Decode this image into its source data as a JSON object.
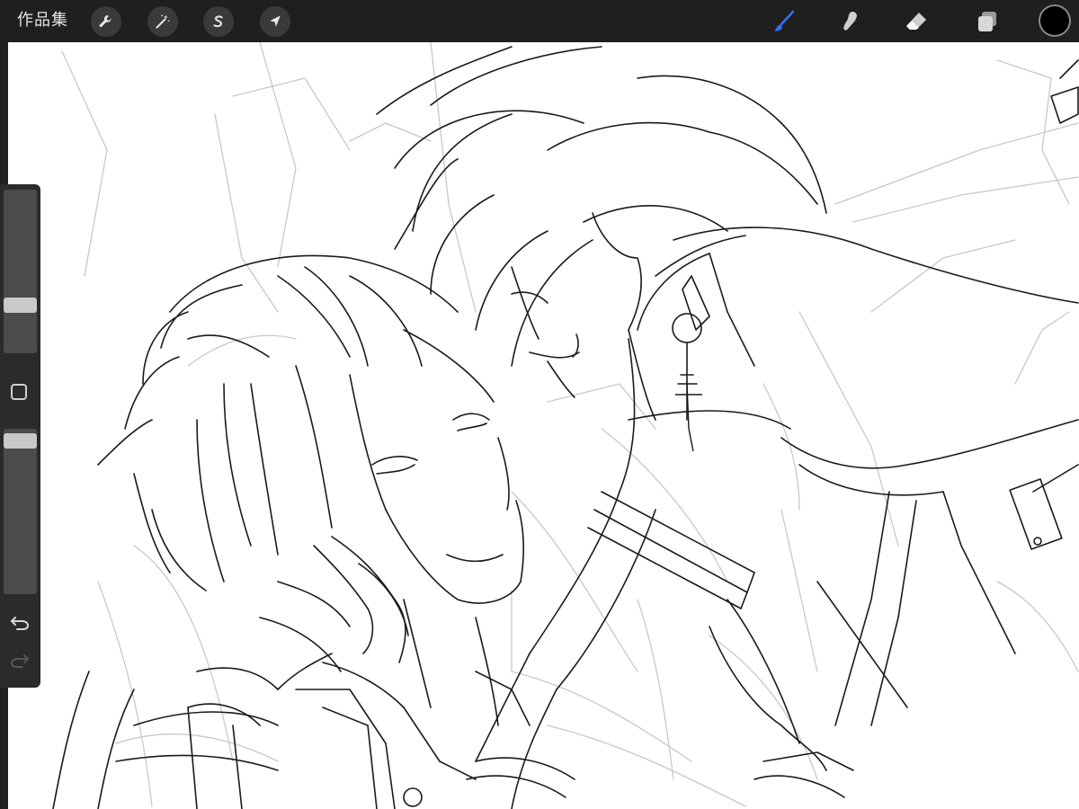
{
  "app": {
    "gallery_label": "作品集"
  },
  "toolbar": {
    "left_tools": [
      {
        "name": "actions",
        "icon": "wrench-icon"
      },
      {
        "name": "adjustments",
        "icon": "magic-wand-icon"
      },
      {
        "name": "selection",
        "icon": "selection-s-icon"
      },
      {
        "name": "transform",
        "icon": "arrow-cursor-icon"
      }
    ],
    "right_tools": [
      {
        "name": "brush",
        "icon": "brush-icon",
        "active": true
      },
      {
        "name": "smudge",
        "icon": "smudge-finger-icon",
        "active": false
      },
      {
        "name": "eraser",
        "icon": "eraser-icon",
        "active": false
      },
      {
        "name": "layers",
        "icon": "layers-icon",
        "active": false
      }
    ],
    "current_color": "#000000",
    "active_color": "#2f6fff"
  },
  "sidebar": {
    "brush_size": 0.27,
    "brush_opacity": 0.97
  },
  "colors": {
    "toolbar_bg": "#1f1f1f",
    "sidebar_bg": "#2b2b2b",
    "canvas_bg": "#ffffff"
  }
}
